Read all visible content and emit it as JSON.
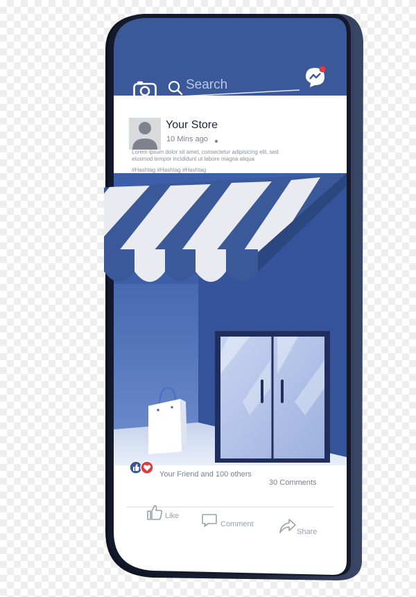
{
  "header": {
    "search_placeholder": "Search",
    "camera_icon": "camera-icon",
    "messenger_icon": "messenger-icon",
    "notification_color": "#e0393e"
  },
  "post": {
    "author": "Your Store",
    "time": "10 Mins ago",
    "body_line1": "Lorem ipsum dolor sit amet, consectetur adipisicing elit, sed",
    "body_line2": "eiusmod tempor incididunt ut labore magna aliqua",
    "hashtags": "#Hashtag #Hashtag #Hashtag"
  },
  "reactions": {
    "text": "Your Friend and 100 others",
    "comments": "30 Comments",
    "like_color": "#3b5998",
    "love_color": "#e0393e"
  },
  "actions": {
    "like": "Like",
    "comment": "Comment",
    "share": "Share"
  },
  "colors": {
    "brand": "#3b5998",
    "phone_frame": "#141a2b",
    "awning_light": "#e9ebf0"
  }
}
